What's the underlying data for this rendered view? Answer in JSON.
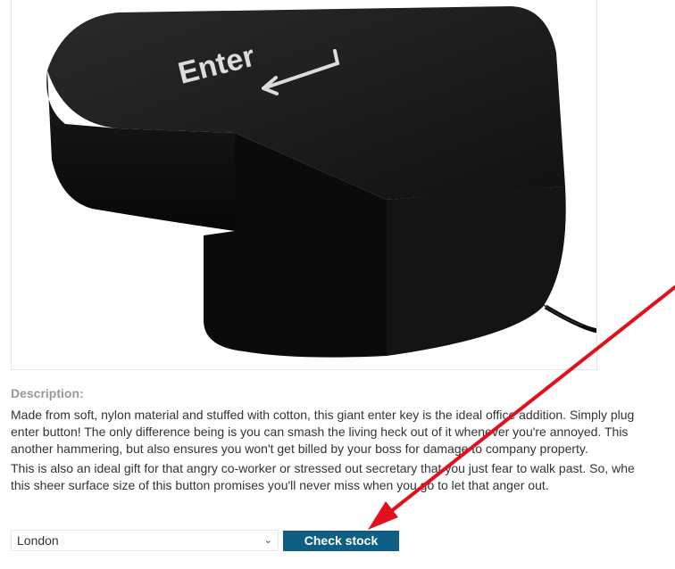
{
  "product": {
    "image_alt": "Giant black enter key pillow",
    "key_label": "Enter"
  },
  "description": {
    "heading": "Description:",
    "paragraph1": [
      "Made from soft, nylon material and stuffed with cotton, this giant enter key is the ideal office addition. Simply plug",
      "enter button! The only difference being is you can smash the living heck out of it whenever you're annoyed. This",
      "another hammering, but also ensures you won't get billed by your boss for damage to company property."
    ],
    "paragraph2": [
      "This is also an ideal gift for that angry co-worker or stressed out secretary that you just fear to walk past. So, whe",
      "this sheer surface size of this button promises you'll never miss when you go to let that anger out."
    ]
  },
  "stock_check": {
    "selected_store": "London",
    "button_label": "Check stock"
  },
  "colors": {
    "button_bg": "#0f5f84",
    "arrow": "#e3101c"
  }
}
